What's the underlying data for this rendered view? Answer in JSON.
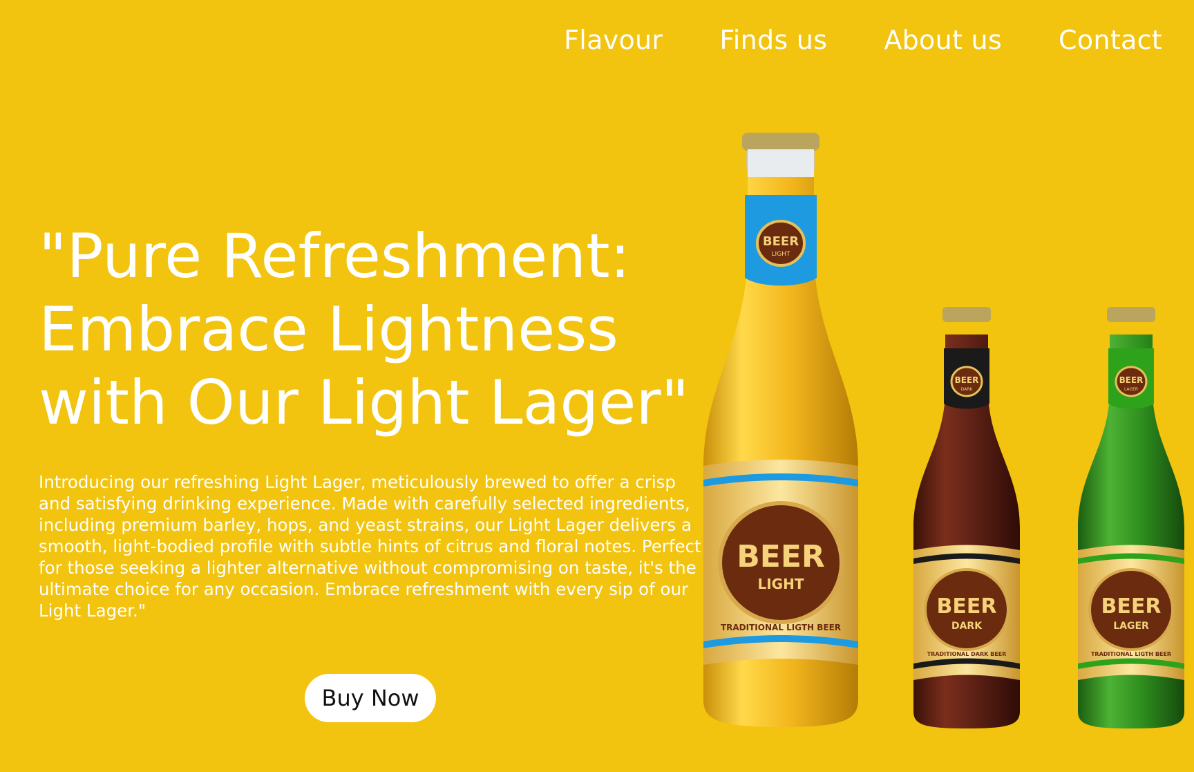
{
  "nav": {
    "items": [
      "Flavour",
      "Finds us",
      "About us",
      "Contact"
    ]
  },
  "hero": {
    "headline_lines": [
      "\"Pure Refreshment:",
      "Embrace Lightness",
      "with Our Light Lager\""
    ],
    "intro": "Introducing our refreshing Light Lager, meticulously brewed to offer a crisp and satisfying drinking experience. Made with carefully selected ingredients, including premium barley, hops, and yeast strains, our Light Lager delivers a smooth, light-bodied profile with subtle hints of citrus and floral notes. Perfect for those seeking a lighter alternative without compromising on taste, it's the ultimate choice for any occasion. Embrace refreshment with every sip of our Light Lager.\"",
    "buy_label": "Buy Now"
  },
  "bottles": [
    {
      "neck_word": "BEER",
      "neck_sub": "LIGHT",
      "word": "BEER",
      "sub": "LIGHT",
      "tagline": "TRADITIONAL LIGTH BEER",
      "glass": "#F2B51C",
      "accent": "#1E9BE0"
    },
    {
      "neck_word": "BEER",
      "neck_sub": "DARK",
      "word": "BEER",
      "sub": "DARK",
      "tagline": "TRADITIONAL DARK BEER",
      "glass": "#5A1F14",
      "accent": "#1A1A1A"
    },
    {
      "neck_word": "BEER",
      "neck_sub": "LAGER",
      "word": "BEER",
      "sub": "LAGER",
      "tagline": "TRADITIONAL LIGTH BEER",
      "glass": "#2E8E1E",
      "accent": "#2EA21A"
    }
  ],
  "colors": {
    "background": "#F2C30F",
    "text": "#FFFFFF",
    "label_gold": "#E8C05A",
    "label_brown": "#6A2B0E"
  }
}
